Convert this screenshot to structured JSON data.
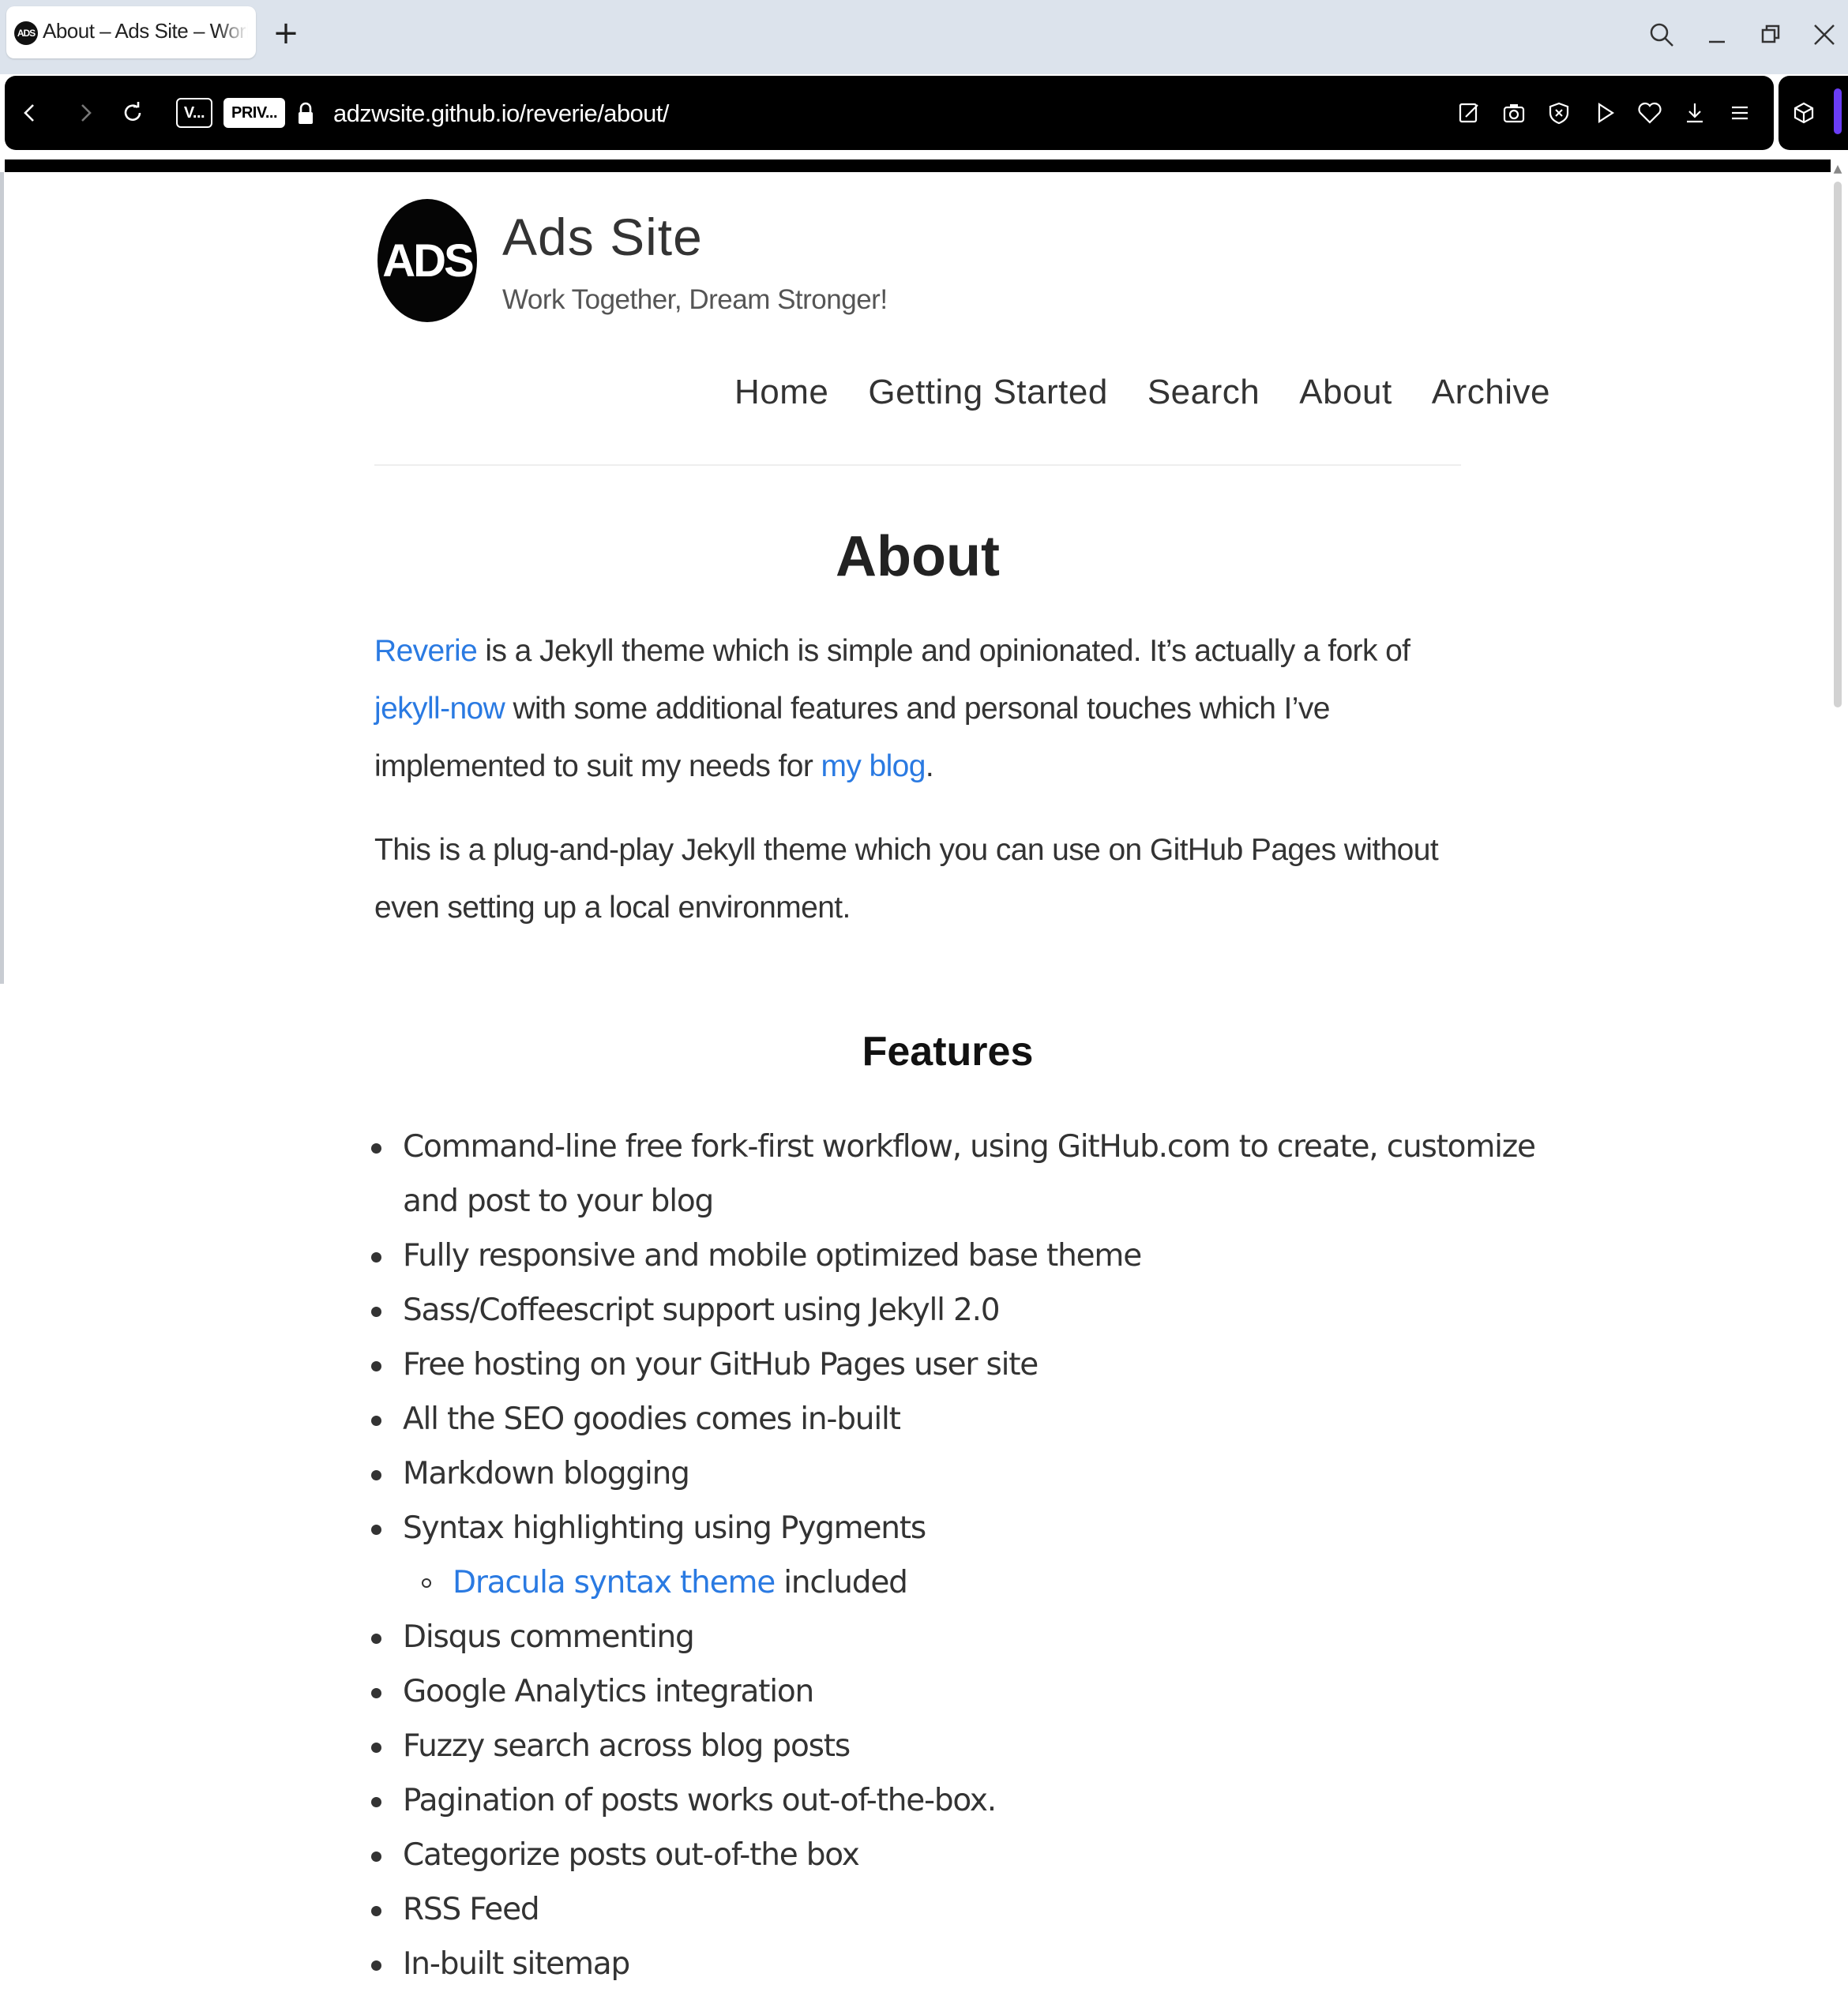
{
  "browser": {
    "tab_title": "About – Ads Site – Work Together, Dream Stronger!",
    "tab_favicon": "ADS",
    "new_tab": "+",
    "vpn_badge": "V...",
    "private_badge": "PRIV...",
    "url": "adzwsite.github.io/reverie/about/",
    "icons": [
      "back-icon",
      "forward-icon",
      "reload-icon",
      "lock-icon",
      "edit-icon",
      "camera-icon",
      "shield-icon",
      "play-icon",
      "heart-icon",
      "download-icon",
      "menu-icon",
      "cube-icon",
      "search-icon",
      "minimize-icon",
      "restore-icon",
      "close-icon"
    ],
    "colors": {
      "tabbar": "#dce3ec",
      "toolbar": "#000000",
      "accent": "#6a3df5"
    }
  },
  "site": {
    "logo_text": "ADS",
    "title": "Ads Site",
    "tagline": "Work Together, Dream Stronger!",
    "nav": [
      "Home",
      "Getting Started",
      "Search",
      "About",
      "Archive"
    ],
    "link_color": "#2a7ae2"
  },
  "page": {
    "title": "About",
    "para1": {
      "link1": "Reverie",
      "text1": " is a Jekyll theme which is simple and opinionated. It’s actually a fork of ",
      "link2": "jekyll-now",
      "text2": " with some additional features and personal touches which I’ve implemented to suit my needs for ",
      "link3": "my blog",
      "text3": "."
    },
    "para2": "This is a plug-and-play Jekyll theme which you can use on GitHub Pages without even setting up a local environment.",
    "features_heading": "Features",
    "features": [
      "Command-line free fork-first workflow, using GitHub.com to create, customize and post to your blog",
      "Fully responsive and mobile optimized base theme",
      "Sass/Coffeescript support using Jekyll 2.0",
      "Free hosting on your GitHub Pages user site",
      "All the SEO goodies comes in-built",
      "Markdown blogging",
      "Syntax highlighting using Pygments",
      "Disqus commenting",
      "Google Analytics integration",
      "Fuzzy search across blog posts",
      "Pagination of posts works out-of-the-box.",
      "Categorize posts out-of-the box",
      "RSS Feed",
      "In-built sitemap"
    ],
    "sub_feature": {
      "link": "Dracula syntax theme",
      "text": " included"
    }
  }
}
